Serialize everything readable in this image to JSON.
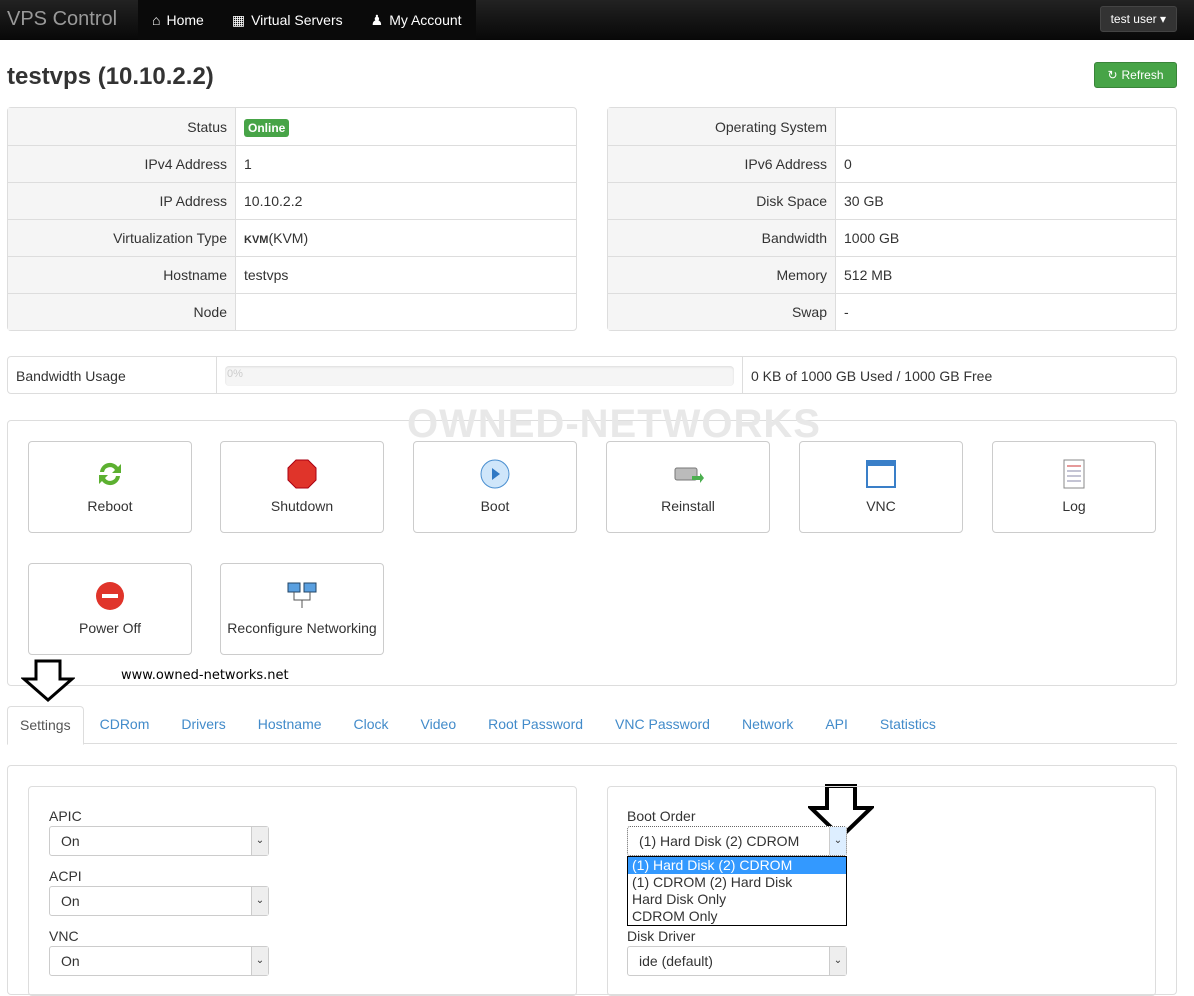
{
  "nav": {
    "brand": "VPS Control",
    "links": [
      {
        "label": "Home",
        "icon": "home-icon"
      },
      {
        "label": "Virtual Servers",
        "icon": "grid-icon"
      },
      {
        "label": "My Account",
        "icon": "user-icon"
      }
    ],
    "user": "test user"
  },
  "title": "testvps (10.10.2.2)",
  "refresh": "Refresh",
  "left_info": [
    {
      "label": "Status",
      "value": "Online"
    },
    {
      "label": "IPv4 Address",
      "value": "1"
    },
    {
      "label": "IP Address",
      "value": "10.10.2.2"
    },
    {
      "label": "Virtualization Type",
      "value": "(KVM)",
      "logo": "KVM"
    },
    {
      "label": "Hostname",
      "value": "testvps"
    },
    {
      "label": "Node",
      "value": ""
    }
  ],
  "right_info": [
    {
      "label": "Operating System",
      "value": ""
    },
    {
      "label": "IPv6 Address",
      "value": "0"
    },
    {
      "label": "Disk Space",
      "value": "30 GB"
    },
    {
      "label": "Bandwidth",
      "value": "1000 GB"
    },
    {
      "label": "Memory",
      "value": "512 MB"
    },
    {
      "label": "Swap",
      "value": "-"
    }
  ],
  "bandwidth": {
    "label": "Bandwidth Usage",
    "percent": 0,
    "percent_text": "0%",
    "summary": "0 KB of 1000 GB Used / 1000 GB Free"
  },
  "watermark": "OWNED-NETWORKS",
  "site": "www.owned-networks.net",
  "actions": [
    "Reboot",
    "Shutdown",
    "Boot",
    "Reinstall",
    "VNC",
    "Log",
    "Power Off",
    "Reconfigure Networking"
  ],
  "tabs": [
    "Settings",
    "CDRom",
    "Drivers",
    "Hostname",
    "Clock",
    "Video",
    "Root Password",
    "VNC Password",
    "Network",
    "API",
    "Statistics"
  ],
  "settings": {
    "apic": {
      "label": "APIC",
      "value": "On"
    },
    "acpi": {
      "label": "ACPI",
      "value": "On"
    },
    "vnc": {
      "label": "VNC",
      "value": "On"
    },
    "boot_order": {
      "label": "Boot Order",
      "value": "(1) Hard Disk (2) CDROM",
      "options": [
        "(1) Hard Disk (2) CDROM",
        "(1) CDROM (2) Hard Disk",
        "Hard Disk Only",
        "CDROM Only"
      ]
    },
    "disk_driver": {
      "label": "Disk Driver",
      "value": "ide (default)"
    }
  }
}
